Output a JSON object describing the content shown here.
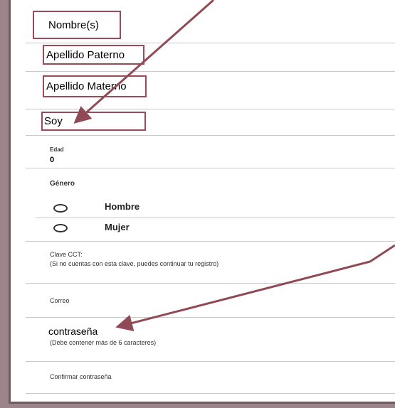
{
  "form": {
    "nombres_placeholder": "Nombre(s)",
    "apellido_paterno_placeholder": "Apellido Paterno",
    "apellido_materno_placeholder": "Apellido Materno",
    "soy_label": "Soy",
    "edad_label": "Edad",
    "edad_value": "0",
    "genero_label": "Género",
    "genero_options": [
      "Hombre",
      "Mujer"
    ],
    "clave_cct_label": "Clave CCT:",
    "clave_cct_hint": "(Si no cuentas con esta clave, puedes continuar tu registro)",
    "correo_label": "Correo",
    "contrasena_label": "contraseña",
    "contrasena_hint": "(Debe contener más de 6 caracteres)",
    "confirmar_label": "Confirmar contraseña"
  },
  "colors": {
    "background": "#9b858b",
    "highlight_border": "#9a4b55",
    "arrow": "#8f4a56"
  }
}
